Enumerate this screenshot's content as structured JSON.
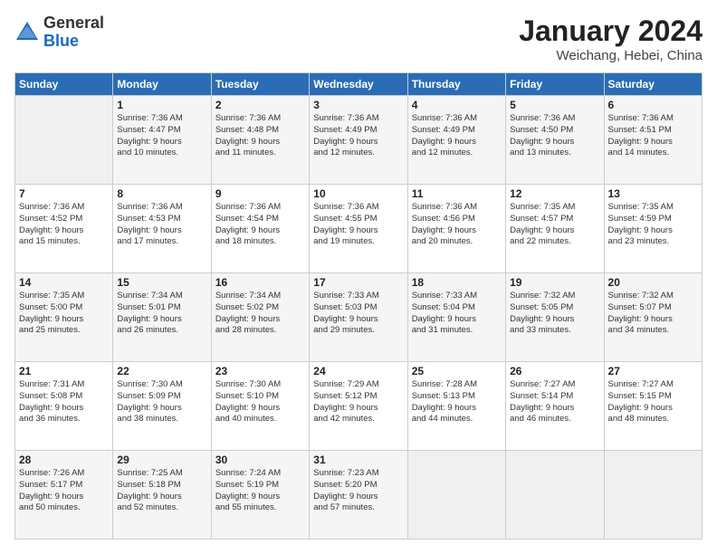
{
  "header": {
    "logo_general": "General",
    "logo_blue": "Blue",
    "month_title": "January 2024",
    "location": "Weichang, Hebei, China"
  },
  "days_of_week": [
    "Sunday",
    "Monday",
    "Tuesday",
    "Wednesday",
    "Thursday",
    "Friday",
    "Saturday"
  ],
  "weeks": [
    [
      {
        "day": "",
        "info": ""
      },
      {
        "day": "1",
        "info": "Sunrise: 7:36 AM\nSunset: 4:47 PM\nDaylight: 9 hours\nand 10 minutes."
      },
      {
        "day": "2",
        "info": "Sunrise: 7:36 AM\nSunset: 4:48 PM\nDaylight: 9 hours\nand 11 minutes."
      },
      {
        "day": "3",
        "info": "Sunrise: 7:36 AM\nSunset: 4:49 PM\nDaylight: 9 hours\nand 12 minutes."
      },
      {
        "day": "4",
        "info": "Sunrise: 7:36 AM\nSunset: 4:49 PM\nDaylight: 9 hours\nand 12 minutes."
      },
      {
        "day": "5",
        "info": "Sunrise: 7:36 AM\nSunset: 4:50 PM\nDaylight: 9 hours\nand 13 minutes."
      },
      {
        "day": "6",
        "info": "Sunrise: 7:36 AM\nSunset: 4:51 PM\nDaylight: 9 hours\nand 14 minutes."
      }
    ],
    [
      {
        "day": "7",
        "info": "Sunrise: 7:36 AM\nSunset: 4:52 PM\nDaylight: 9 hours\nand 15 minutes."
      },
      {
        "day": "8",
        "info": "Sunrise: 7:36 AM\nSunset: 4:53 PM\nDaylight: 9 hours\nand 17 minutes."
      },
      {
        "day": "9",
        "info": "Sunrise: 7:36 AM\nSunset: 4:54 PM\nDaylight: 9 hours\nand 18 minutes."
      },
      {
        "day": "10",
        "info": "Sunrise: 7:36 AM\nSunset: 4:55 PM\nDaylight: 9 hours\nand 19 minutes."
      },
      {
        "day": "11",
        "info": "Sunrise: 7:36 AM\nSunset: 4:56 PM\nDaylight: 9 hours\nand 20 minutes."
      },
      {
        "day": "12",
        "info": "Sunrise: 7:35 AM\nSunset: 4:57 PM\nDaylight: 9 hours\nand 22 minutes."
      },
      {
        "day": "13",
        "info": "Sunrise: 7:35 AM\nSunset: 4:59 PM\nDaylight: 9 hours\nand 23 minutes."
      }
    ],
    [
      {
        "day": "14",
        "info": "Sunrise: 7:35 AM\nSunset: 5:00 PM\nDaylight: 9 hours\nand 25 minutes."
      },
      {
        "day": "15",
        "info": "Sunrise: 7:34 AM\nSunset: 5:01 PM\nDaylight: 9 hours\nand 26 minutes."
      },
      {
        "day": "16",
        "info": "Sunrise: 7:34 AM\nSunset: 5:02 PM\nDaylight: 9 hours\nand 28 minutes."
      },
      {
        "day": "17",
        "info": "Sunrise: 7:33 AM\nSunset: 5:03 PM\nDaylight: 9 hours\nand 29 minutes."
      },
      {
        "day": "18",
        "info": "Sunrise: 7:33 AM\nSunset: 5:04 PM\nDaylight: 9 hours\nand 31 minutes."
      },
      {
        "day": "19",
        "info": "Sunrise: 7:32 AM\nSunset: 5:05 PM\nDaylight: 9 hours\nand 33 minutes."
      },
      {
        "day": "20",
        "info": "Sunrise: 7:32 AM\nSunset: 5:07 PM\nDaylight: 9 hours\nand 34 minutes."
      }
    ],
    [
      {
        "day": "21",
        "info": "Sunrise: 7:31 AM\nSunset: 5:08 PM\nDaylight: 9 hours\nand 36 minutes."
      },
      {
        "day": "22",
        "info": "Sunrise: 7:30 AM\nSunset: 5:09 PM\nDaylight: 9 hours\nand 38 minutes."
      },
      {
        "day": "23",
        "info": "Sunrise: 7:30 AM\nSunset: 5:10 PM\nDaylight: 9 hours\nand 40 minutes."
      },
      {
        "day": "24",
        "info": "Sunrise: 7:29 AM\nSunset: 5:12 PM\nDaylight: 9 hours\nand 42 minutes."
      },
      {
        "day": "25",
        "info": "Sunrise: 7:28 AM\nSunset: 5:13 PM\nDaylight: 9 hours\nand 44 minutes."
      },
      {
        "day": "26",
        "info": "Sunrise: 7:27 AM\nSunset: 5:14 PM\nDaylight: 9 hours\nand 46 minutes."
      },
      {
        "day": "27",
        "info": "Sunrise: 7:27 AM\nSunset: 5:15 PM\nDaylight: 9 hours\nand 48 minutes."
      }
    ],
    [
      {
        "day": "28",
        "info": "Sunrise: 7:26 AM\nSunset: 5:17 PM\nDaylight: 9 hours\nand 50 minutes."
      },
      {
        "day": "29",
        "info": "Sunrise: 7:25 AM\nSunset: 5:18 PM\nDaylight: 9 hours\nand 52 minutes."
      },
      {
        "day": "30",
        "info": "Sunrise: 7:24 AM\nSunset: 5:19 PM\nDaylight: 9 hours\nand 55 minutes."
      },
      {
        "day": "31",
        "info": "Sunrise: 7:23 AM\nSunset: 5:20 PM\nDaylight: 9 hours\nand 57 minutes."
      },
      {
        "day": "",
        "info": ""
      },
      {
        "day": "",
        "info": ""
      },
      {
        "day": "",
        "info": ""
      }
    ]
  ]
}
